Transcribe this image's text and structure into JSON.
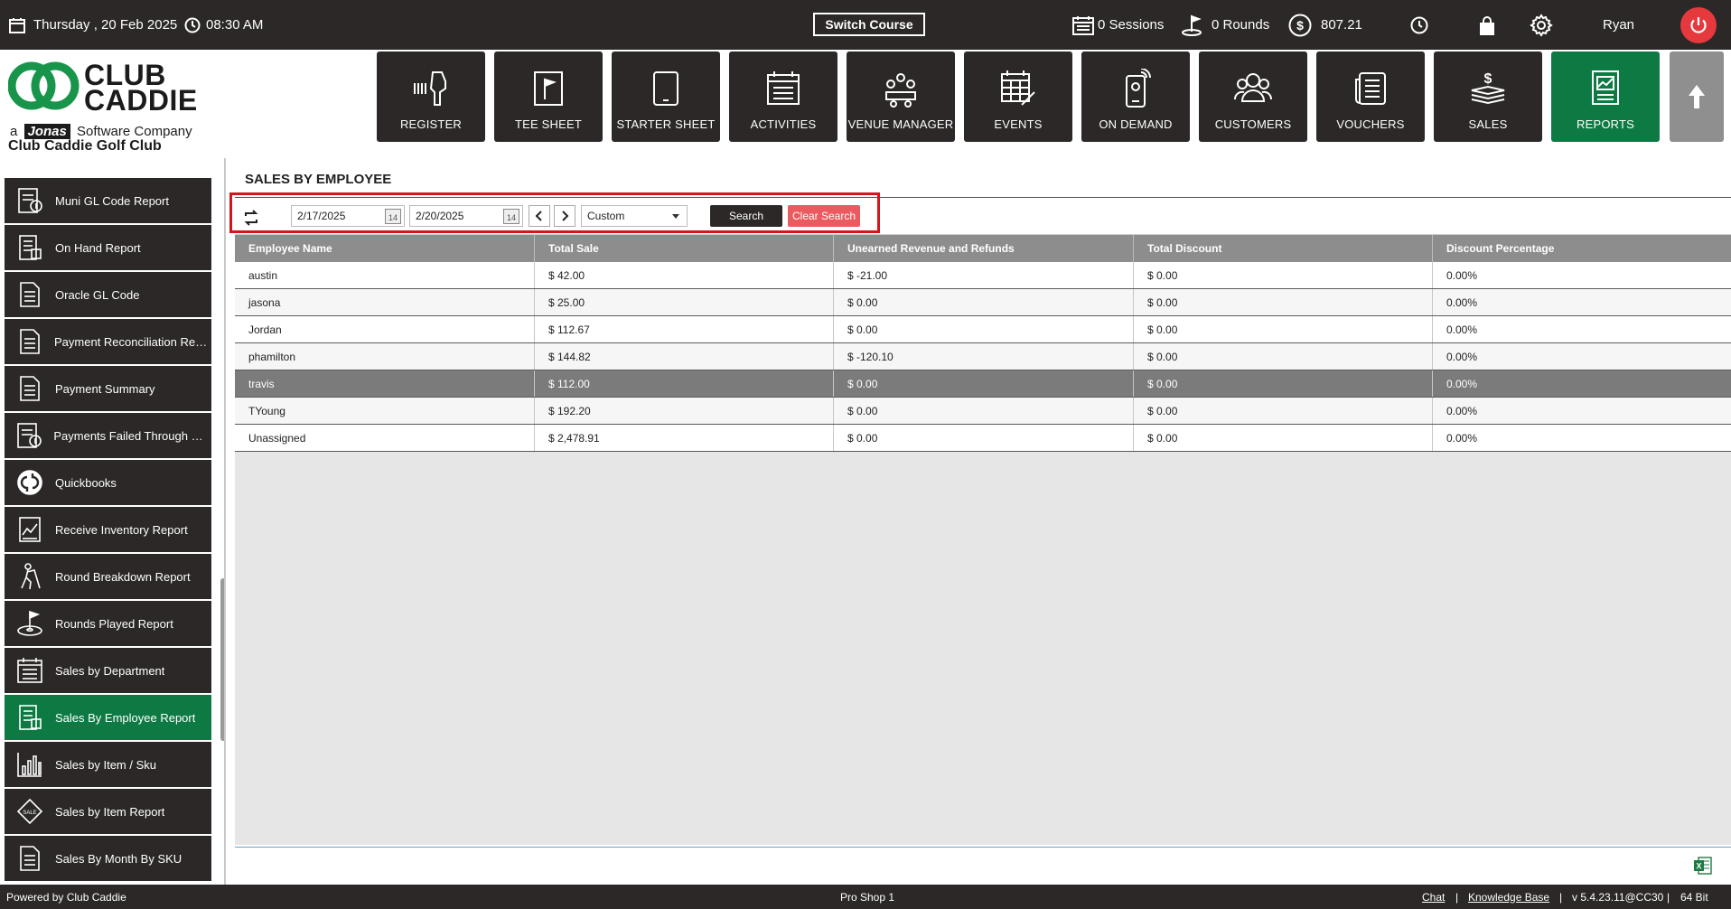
{
  "topbar": {
    "date": "Thursday ,  20 Feb 2025",
    "time": "08:30 AM",
    "switch_course": "Switch Course",
    "sessions": "0 Sessions",
    "rounds": "0 Rounds",
    "balance": "807.21",
    "user": "Ryan"
  },
  "logo": {
    "title_line1": "CLUB",
    "title_line2": "CADDIE",
    "subtitle_prefix": "a",
    "subtitle_brand": "Jonas",
    "subtitle_suffix": "Software Company",
    "club_name": "Club Caddie Golf Club"
  },
  "nav": [
    {
      "label": "REGISTER",
      "icon": "scanner-icon"
    },
    {
      "label": "TEE SHEET",
      "icon": "flag-icon"
    },
    {
      "label": "STARTER SHEET",
      "icon": "tablet-icon"
    },
    {
      "label": "ACTIVITIES",
      "icon": "calendar-list-icon"
    },
    {
      "label": "VENUE MANAGER",
      "icon": "meeting-icon"
    },
    {
      "label": "EVENTS",
      "icon": "calendar-edit-icon"
    },
    {
      "label": "ON DEMAND",
      "icon": "mobile-icon"
    },
    {
      "label": "CUSTOMERS",
      "icon": "users-icon"
    },
    {
      "label": "VOUCHERS",
      "icon": "voucher-icon"
    },
    {
      "label": "SALES",
      "icon": "money-icon"
    },
    {
      "label": "REPORTS",
      "icon": "report-icon"
    }
  ],
  "sidebar": {
    "items": [
      {
        "label": "Muni GL Code Report",
        "icon": "report-grid-icon"
      },
      {
        "label": "On Hand Report",
        "icon": "report-list-icon"
      },
      {
        "label": "Oracle GL Code",
        "icon": "document-icon"
      },
      {
        "label": "Payment Reconciliation Report",
        "icon": "document-icon"
      },
      {
        "label": "Payment Summary",
        "icon": "document-icon"
      },
      {
        "label": "Payments Failed Through Wa...",
        "icon": "report-grid-icon"
      },
      {
        "label": "Quickbooks",
        "icon": "quickbooks-icon"
      },
      {
        "label": "Receive Inventory Report",
        "icon": "chart-doc-icon"
      },
      {
        "label": "Round Breakdown Report",
        "icon": "golfer-icon"
      },
      {
        "label": "Rounds Played Report",
        "icon": "golf-hole-icon"
      },
      {
        "label": "Sales by Department",
        "icon": "calendar-list-icon"
      },
      {
        "label": "Sales By Employee Report",
        "icon": "report-list-icon"
      },
      {
        "label": "Sales by Item / Sku",
        "icon": "bar-chart-icon"
      },
      {
        "label": "Sales by Item Report",
        "icon": "sale-tag-icon"
      },
      {
        "label": "Sales By Month By SKU",
        "icon": "document-icon"
      }
    ],
    "active_index": 11
  },
  "report": {
    "title": "SALES BY EMPLOYEE",
    "start_date": "2/17/2025",
    "end_date": "2/20/2025",
    "calendar_day": "14",
    "period": "Custom",
    "search_label": "Search",
    "clear_label": "Clear Search",
    "columns": [
      "Employee Name",
      "Total Sale",
      "Unearned Revenue and Refunds",
      "Total Discount",
      "Discount Percentage"
    ],
    "rows": [
      [
        "austin",
        "$ 42.00",
        "$ -21.00",
        "$ 0.00",
        "0.00%"
      ],
      [
        "jasona",
        "$ 25.00",
        "$ 0.00",
        "$ 0.00",
        "0.00%"
      ],
      [
        "Jordan",
        "$ 112.67",
        "$ 0.00",
        "$ 0.00",
        "0.00%"
      ],
      [
        "phamilton",
        "$ 144.82",
        "$ -120.10",
        "$ 0.00",
        "0.00%"
      ],
      [
        "travis",
        "$ 112.00",
        "$ 0.00",
        "$ 0.00",
        "0.00%"
      ],
      [
        "TYoung",
        "$ 192.20",
        "$ 0.00",
        "$ 0.00",
        "0.00%"
      ],
      [
        "Unassigned",
        "$ 2,478.91",
        "$ 0.00",
        "$ 0.00",
        "0.00%"
      ]
    ],
    "selected_row": 4,
    "excel_label": "X"
  },
  "statusbar": {
    "powered_by": "Powered by Club Caddie",
    "location": "Pro Shop 1",
    "chat": "Chat",
    "sep1": "|",
    "knowledge_base": "Knowledge Base",
    "sep2": "|",
    "version": "v 5.4.23.11@CC30",
    "sep3": "|",
    "bits": "64 Bit"
  },
  "colors": {
    "dark": "#2b2827",
    "accent_green": "#0e7a43",
    "highlight_red": "#d4151c",
    "clear_button": "#ea5a5e",
    "power_red": "#e5393e"
  }
}
